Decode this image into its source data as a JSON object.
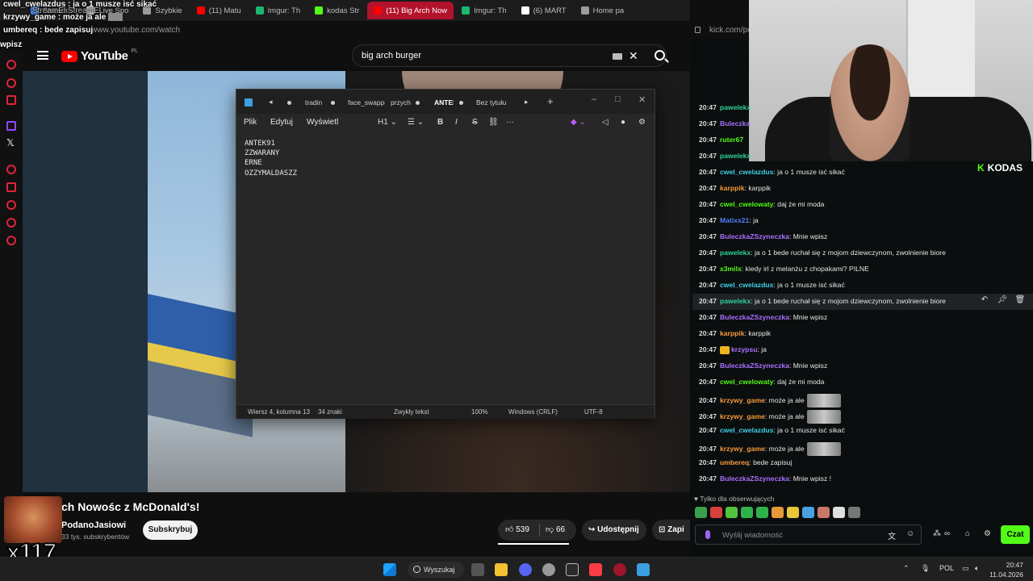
{
  "browser": {
    "tabs": [
      {
        "label": "Stream -",
        "color": "#3b82f6"
      },
      {
        "label": "Live Spo",
        "color": "#dddddd"
      },
      {
        "label": "Szybkie",
        "color": "#9c9c9c"
      },
      {
        "label": "(11) Matu",
        "color": "#ff0000"
      },
      {
        "label": "Imgur: Th",
        "color": "#1bb76e"
      },
      {
        "label": "kodas Str",
        "color": "#53fc18"
      },
      {
        "label": "(11) Big Arch Now",
        "color": "#ff0000",
        "active": true
      },
      {
        "label": "Imgur: Th",
        "color": "#1bb76e"
      },
      {
        "label": "(6) MART",
        "color": "#ffffff"
      },
      {
        "label": "Home pa",
        "color": "#9c9c9c"
      }
    ],
    "url": "www.youtube.com/watch",
    "kick_url": "kick.com/pc"
  },
  "overlay_chat": [
    {
      "user": "cwel_cwelazdus",
      "text": "ja o 1 musze isć sikać"
    },
    {
      "user": "",
      "text": "StreamEl    StreamEl"
    },
    {
      "user": "krzywy_game",
      "text": "może ja ale"
    },
    {
      "user": "umbereq",
      "text": "bede zapisuj"
    },
    {
      "user": "",
      "text": "wpisz !"
    }
  ],
  "youtube": {
    "logo_text": "YouTube",
    "region": "PL",
    "search_query": "big arch burger",
    "video_title": "ch Nowośc z McDonald's!",
    "channel": "PodanoJasiowi",
    "subscribers": "33 tys. subskrybentów",
    "subscribe_label": "Subskrybuj",
    "likes": "539",
    "dislikes": "66",
    "share_label": "Udostępnij",
    "save_label": "Zapi"
  },
  "overlay_emote_text": "x117",
  "notepad": {
    "tabs": [
      "tradin",
      "face_swappe",
      "przych",
      "ANTEK",
      "Bez tytułu"
    ],
    "menu": [
      "Plik",
      "Edytuj",
      "Wyświetl"
    ],
    "heading_tool": "H1",
    "lines": [
      "ANTEK91",
      "ZZWARANY",
      "ERNE",
      "OZZYMALDASZZ"
    ],
    "status": {
      "position": "Wiersz 4, kolumna 13",
      "chars": "34 znaki",
      "format": "Zwykły tekst",
      "zoom": "100%",
      "eol": "Windows (CRLF)",
      "encoding": "UTF-8"
    }
  },
  "kick": {
    "badge": "KODAS",
    "messages": [
      {
        "time": "20:47",
        "user": "pawelekx",
        "color": "#2fd39a",
        "text": ""
      },
      {
        "time": "20:47",
        "user": "Buleczka",
        "color": "#a970ff",
        "text": ""
      },
      {
        "time": "20:47",
        "user": "ruter67",
        "color": "#53fc18",
        "text": ""
      },
      {
        "time": "20:47",
        "user": "pawelekx",
        "color": "#2fd39a",
        "text": ""
      },
      {
        "time": "20:47",
        "user": "cwel_cwelazdus",
        "color": "#3fd0e6",
        "text": "ja o 1 musze isć sikać"
      },
      {
        "time": "20:47",
        "user": "karppik",
        "color": "#f59a3b",
        "text": "karppik"
      },
      {
        "time": "20:47",
        "user": "cwel_cwelowaty",
        "color": "#53fc18",
        "text": "daj że mi moda"
      },
      {
        "time": "20:47",
        "user": "Matixx21",
        "color": "#4f7dff",
        "text": "ja"
      },
      {
        "time": "20:47",
        "user": "BuleczkaZSzyneczka",
        "color": "#a970ff",
        "text": "Mnie wpisz"
      },
      {
        "time": "20:47",
        "user": "pawelekx",
        "color": "#2fd39a",
        "text": "ja o 1 bede ruchał się z mojom dziewczynom, zwolnienie biore"
      },
      {
        "time": "20:47",
        "user": "x3milx",
        "color": "#53fc18",
        "text": "kiedy irl z melanżu z chopakami? PILNE"
      },
      {
        "time": "20:47",
        "user": "cwel_cwelazdus",
        "color": "#3fd0e6",
        "text": "ja o 1 musze isć sikać"
      },
      {
        "time": "20:47",
        "user": "pawelekx",
        "color": "#2fd39a",
        "text": "ja o 1 bede ruchał się z mojom dziewczynom, zwolnienie biore"
      },
      {
        "time": "20:47",
        "user": "BuleczkaZSzyneczka",
        "color": "#a970ff",
        "text": "Mnie wpisz"
      },
      {
        "time": "20:47",
        "user": "karppik",
        "color": "#f59a3b",
        "text": "karppik"
      },
      {
        "time": "20:47",
        "user": "krzypsu",
        "color": "#a970ff",
        "text": "ja",
        "crown": true
      },
      {
        "time": "20:47",
        "user": "BuleczkaZSzyneczka",
        "color": "#a970ff",
        "text": "Mnie wpisz"
      },
      {
        "time": "20:47",
        "user": "cwel_cwelowaty",
        "color": "#53fc18",
        "text": "daj że mi moda"
      },
      {
        "time": "20:47",
        "user": "krzywy_game",
        "color": "#f59a3b",
        "text": "może ja ale",
        "emote": true
      },
      {
        "time": "20:47",
        "user": "krzywy_game",
        "color": "#f59a3b",
        "text": "może ja ale",
        "emote": true
      },
      {
        "time": "20:47",
        "user": "cwel_cwelazdus",
        "color": "#3fd0e6",
        "text": "ja o 1 musze isć sikać"
      },
      {
        "time": "20:47",
        "user": "krzywy_game",
        "color": "#f59a3b",
        "text": "może ja ale",
        "emote": true
      },
      {
        "time": "20:47",
        "user": "umbereq",
        "color": "#f59a3b",
        "text": "bede zapisuj"
      },
      {
        "time": "20:47",
        "user": "BuleczkaZSzyneczka",
        "color": "#a970ff",
        "text": "Mnie wpisz !"
      }
    ],
    "followers_only": "Tylko dla obserwujących",
    "input_placeholder": "Wyślij wiadomość",
    "chat_button": "Czat"
  },
  "taskbar": {
    "search_label": "Wyszukaj",
    "lang": "POL",
    "time": "20:47",
    "date": "11.04.2026"
  }
}
